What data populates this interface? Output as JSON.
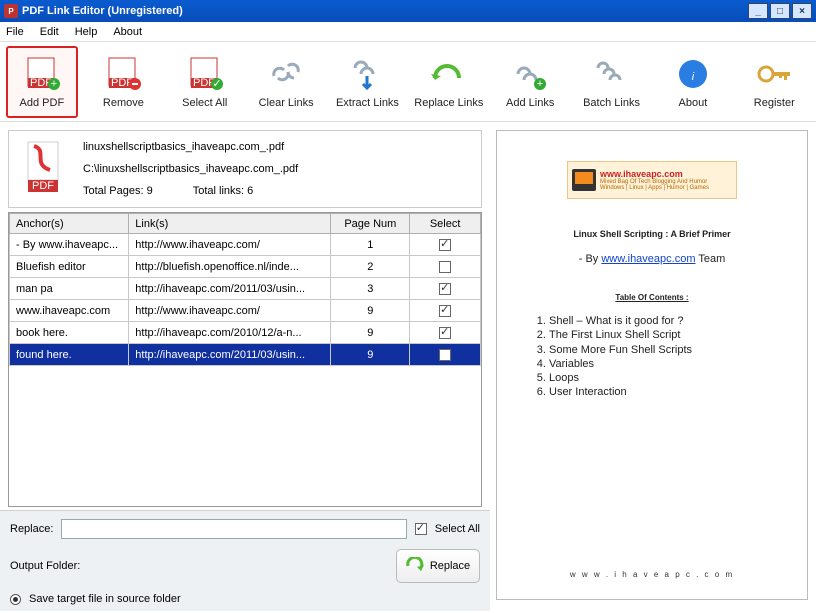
{
  "window": {
    "title": "PDF Link Editor (Unregistered)"
  },
  "menu": {
    "file": "File",
    "edit": "Edit",
    "help": "Help",
    "about": "About"
  },
  "toolbar": {
    "addpdf": "Add PDF",
    "remove": "Remove",
    "selectall": "Select All",
    "clearlinks": "Clear Links",
    "extractlinks": "Extract Links",
    "replacelinks": "Replace Links",
    "addlinks": "Add Links",
    "batchlinks": "Batch Links",
    "about": "About",
    "register": "Register"
  },
  "fileinfo": {
    "filename": "linuxshellscriptbasics_ihaveapc.com_.pdf",
    "path": "C:\\linuxshellscriptbasics_ihaveapc.com_.pdf",
    "pages_label": "Total Pages:",
    "pages_value": "9",
    "links_label": "Total links:",
    "links_value": "6"
  },
  "grid": {
    "headers": {
      "anchor": "Anchor(s)",
      "link": "Link(s)",
      "page": "Page Num",
      "select": "Select"
    },
    "rows": [
      {
        "anchor": "- By www.ihaveapc...",
        "link": "http://www.ihaveapc.com/",
        "page": "1",
        "checked": true,
        "selected": false
      },
      {
        "anchor": "Bluefish   editor",
        "link": "http://bluefish.openoffice.nl/inde...",
        "page": "2",
        "checked": false,
        "selected": false
      },
      {
        "anchor": "man pa",
        "link": "http://ihaveapc.com/2011/03/usin...",
        "page": "3",
        "checked": true,
        "selected": false
      },
      {
        "anchor": "www.ihaveapc.com",
        "link": "http://www.ihaveapc.com/",
        "page": "9",
        "checked": true,
        "selected": false
      },
      {
        "anchor": "book here.",
        "link": "http://ihaveapc.com/2010/12/a-n...",
        "page": "9",
        "checked": true,
        "selected": false
      },
      {
        "anchor": "found here.",
        "link": "http://ihaveapc.com/2011/03/usin...",
        "page": "9",
        "checked": true,
        "selected": true
      }
    ]
  },
  "bottom": {
    "replace_label": "Replace:",
    "replace_value": "",
    "selectall_label": "Select All",
    "selectall_checked": true,
    "output_label": "Output Folder:",
    "replace_btn": "Replace",
    "radio_label": "Save target file in source folder",
    "radio_on": true
  },
  "preview": {
    "banner": {
      "l1": "www.ihaveapc.com",
      "l2": "Mixed Bag Of Tech Blogging And Humor",
      "l3": "Windows | Linux | Apps | Humor | Games"
    },
    "title": "Linux Shell Scripting : A Brief Primer",
    "by_pre": "- By ",
    "by_link": "www.ihaveapc.com",
    "by_post": " Team",
    "toc": "Table Of Contents :",
    "items": [
      "Shell – What is it good for ?",
      "The First Linux Shell Script",
      "Some More Fun Shell Scripts",
      "Variables",
      "Loops",
      "User Interaction"
    ],
    "foot": "w w w . i h a v e a p c . c o m"
  }
}
